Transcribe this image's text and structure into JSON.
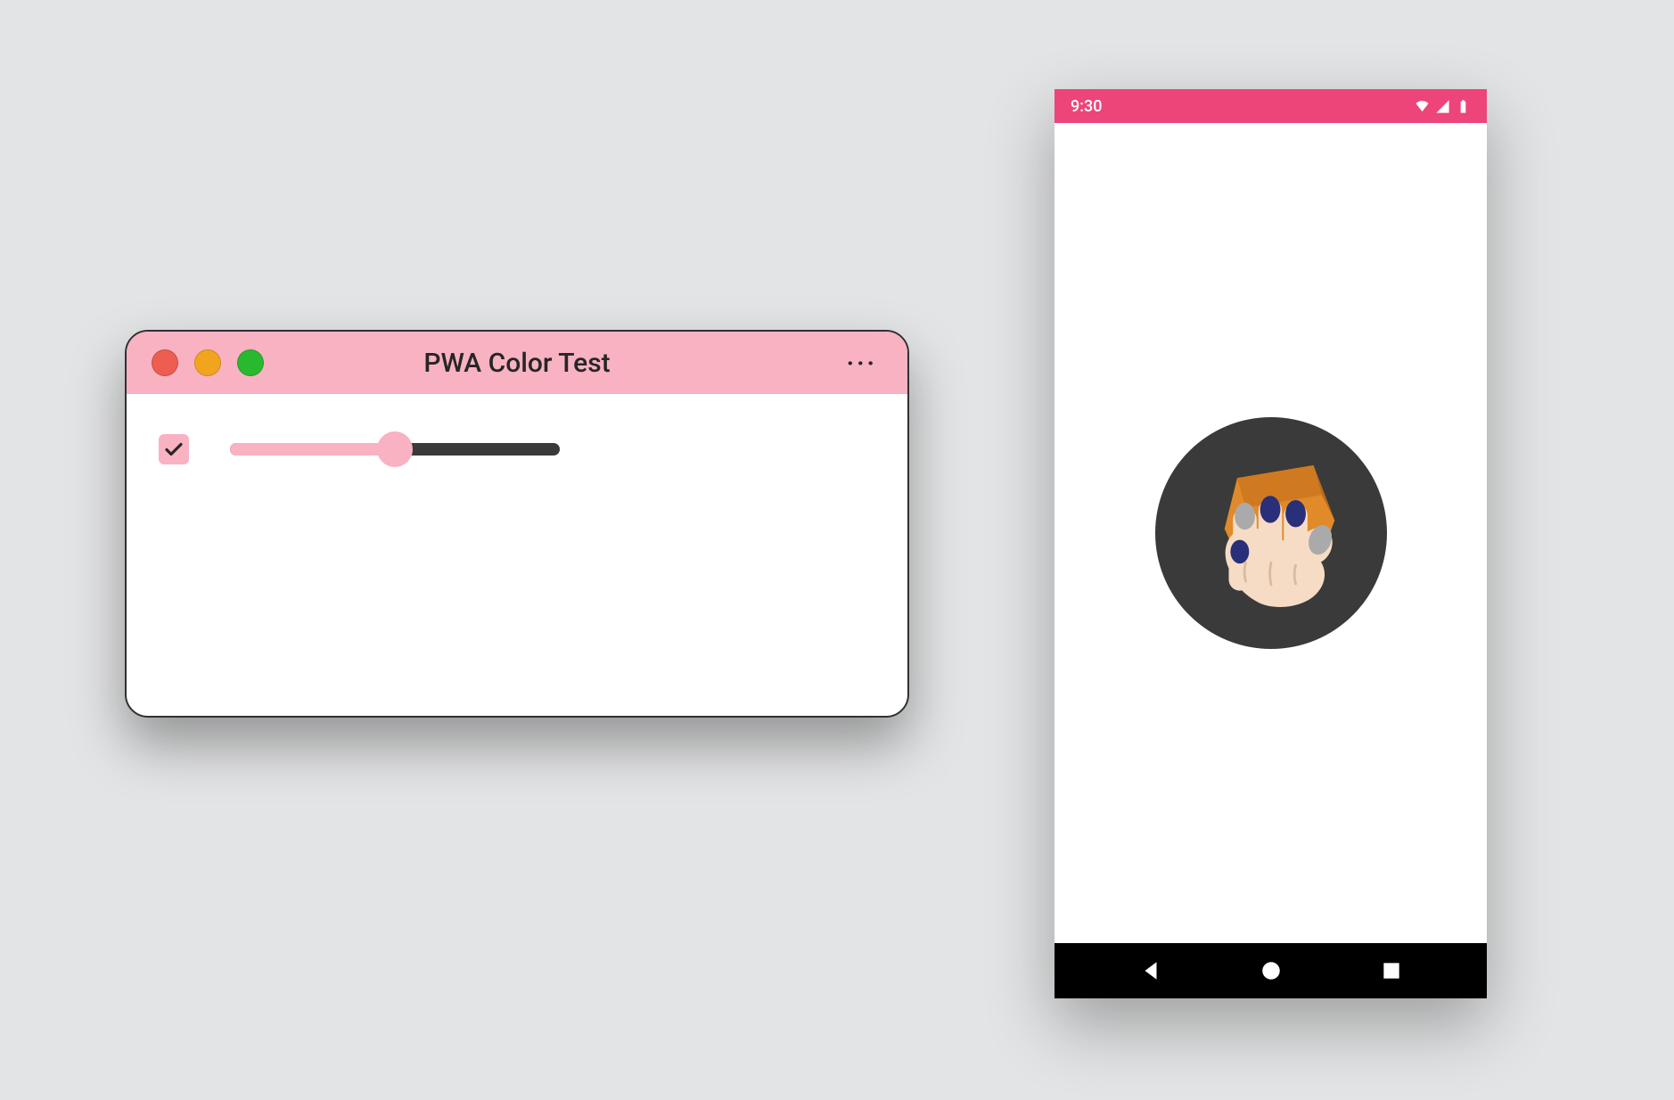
{
  "colors": {
    "theme_pink": "#f8b2c2",
    "phone_status": "#ed4579",
    "canvas": "#e3e4e5",
    "dark": "#3a3a3a"
  },
  "desktop": {
    "title": "PWA Color Test",
    "menu_glyph": "···",
    "traffic_lights": {
      "close": "close-icon",
      "minimize": "minimize-icon",
      "zoom": "zoom-icon"
    },
    "checkbox": {
      "checked": true
    },
    "slider": {
      "value": 50,
      "min": 0,
      "max": 100
    }
  },
  "phone": {
    "status": {
      "time": "9:30",
      "icons": [
        "wifi-icon",
        "cell-signal-icon",
        "battery-icon"
      ]
    },
    "splash": {
      "icon_name": "app-crush-icon"
    },
    "navbar": {
      "back": "nav-back-icon",
      "home": "nav-home-icon",
      "recents": "nav-recents-icon"
    }
  }
}
